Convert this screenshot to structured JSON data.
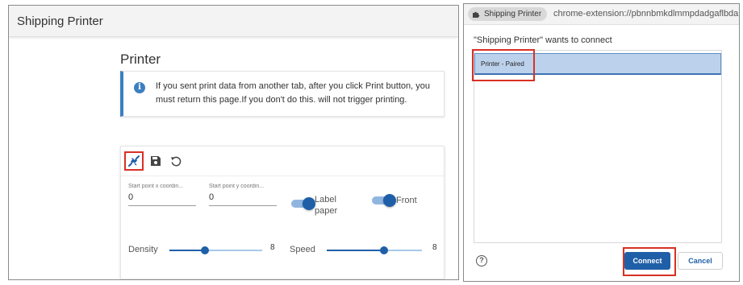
{
  "app": {
    "title": "Shipping Printer"
  },
  "page": {
    "title": "Printer",
    "alert": {
      "icon": "info-icon",
      "text": "If you sent print data from another tab, after you click Print button, you must return this page.If you don't do this. will not trigger printing."
    }
  },
  "toolbar": {
    "icons": [
      "plug-connect-icon",
      "save-icon",
      "reset-icon"
    ]
  },
  "settings": {
    "start_x": {
      "label": "Start point x coordin...",
      "value": "0"
    },
    "start_y": {
      "label": "Start point y coordin...",
      "value": "0"
    },
    "label_paper": {
      "label": "Label paper",
      "on": true
    },
    "front": {
      "label": "Front",
      "on": true
    },
    "density": {
      "label": "Density",
      "value": "8",
      "fraction": 0.38
    },
    "speed": {
      "label": "Speed",
      "value": "8",
      "fraction": 0.6
    }
  },
  "dialog": {
    "chip_label": "Shipping Printer",
    "url": "chrome-extension://pbnnbmkdlmmpdadgaflbda",
    "message": "\"Shipping Printer\" wants to connect",
    "devices": [
      "Printer - Paired"
    ],
    "connect_label": "Connect",
    "cancel_label": "Cancel"
  },
  "colors": {
    "accent": "#1f5fa8",
    "alert_border": "#3d7fc1",
    "highlight": "#d93025"
  }
}
